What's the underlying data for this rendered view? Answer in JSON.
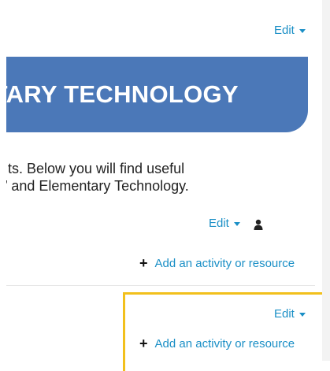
{
  "top_edit": {
    "label": "Edit"
  },
  "banner": {
    "title": "NTARY TECHNOLOGY"
  },
  "intro": {
    "line1": "ts. Below you will find useful",
    "line2": "’ and Elementary Technology."
  },
  "section1": {
    "edit_label": "Edit",
    "add_label": "Add an activity or resource"
  },
  "section2": {
    "edit_label": "Edit",
    "add_label": "Add an activity or resource"
  },
  "colors": {
    "link": "#1a8fc6",
    "banner": "#4b78b8",
    "highlight": "#f2c01c"
  },
  "icons": {
    "caret": "chevron-down-icon",
    "person": "user-icon",
    "plus": "plus-icon"
  }
}
